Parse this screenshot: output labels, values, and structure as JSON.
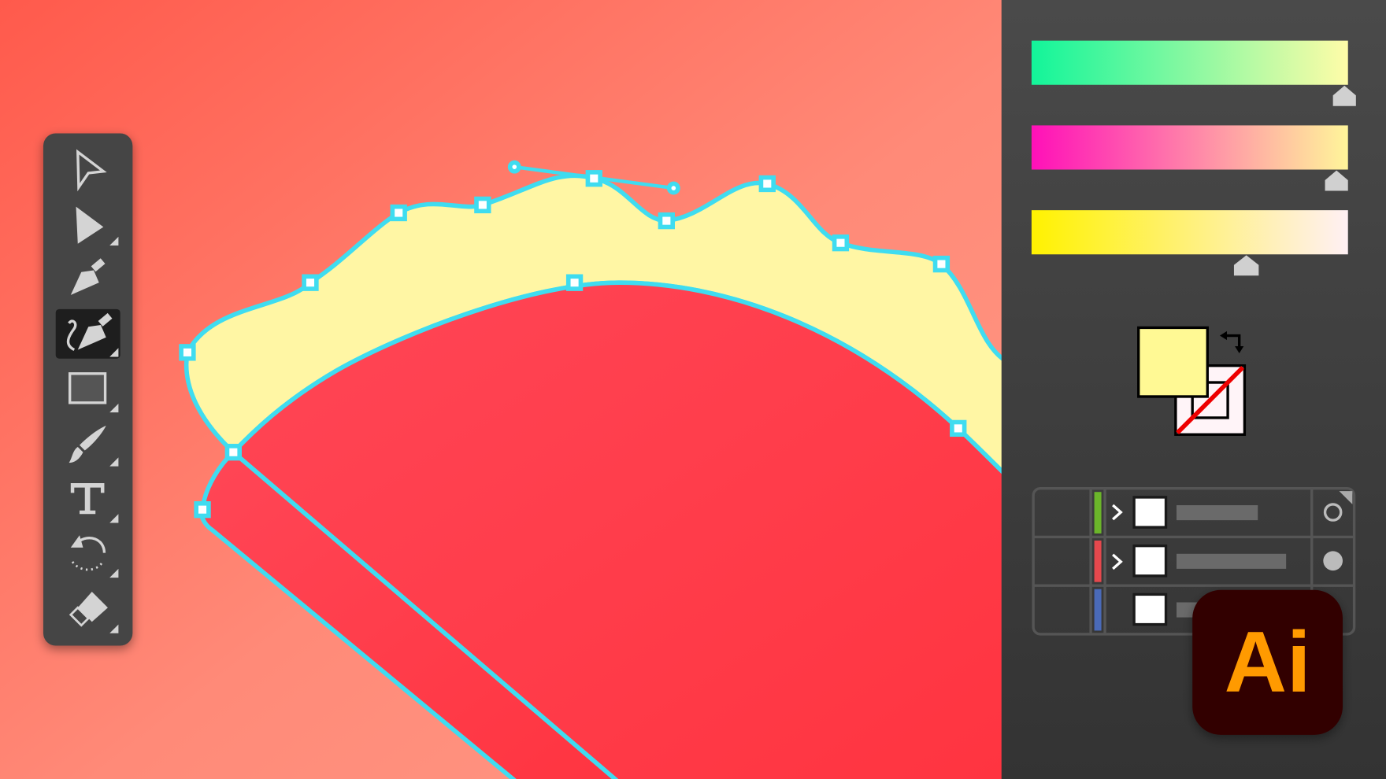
{
  "app": {
    "logo_text": "Ai",
    "logo_bg": "#330000",
    "logo_fg": "#ff9a00"
  },
  "canvas": {
    "fill_color": "#fff8a6",
    "shape_color": "#ff4654",
    "path_color": "#3fdcf0"
  },
  "toolbar": {
    "tools": [
      {
        "name": "selection-tool",
        "active": false
      },
      {
        "name": "direct-selection-tool",
        "active": false
      },
      {
        "name": "pen-tool",
        "active": false
      },
      {
        "name": "curvature-tool",
        "active": true
      },
      {
        "name": "rectangle-tool",
        "active": false
      },
      {
        "name": "paintbrush-tool",
        "active": false
      },
      {
        "name": "type-tool",
        "active": false
      },
      {
        "name": "rotate-tool",
        "active": false
      },
      {
        "name": "eraser-tool",
        "active": false
      }
    ]
  },
  "gradients": [
    {
      "from": "#12f59a",
      "to": "#fffca8",
      "slider": 0.99
    },
    {
      "from": "#ff10b8",
      "to": "#fff59a",
      "slider": 0.96
    },
    {
      "from": "#fff200",
      "to": "#fff0f4",
      "slider": 0.68
    }
  ],
  "fill_stroke": {
    "fill": "#fff994",
    "stroke": "none"
  },
  "layers": [
    {
      "color": "#6bb52a",
      "expandable": true,
      "visible_state": "outline"
    },
    {
      "color": "#e5484d",
      "expandable": true,
      "visible_state": "filled"
    },
    {
      "color": "#4a6ab8",
      "expandable": false,
      "visible_state": "hidden"
    }
  ]
}
